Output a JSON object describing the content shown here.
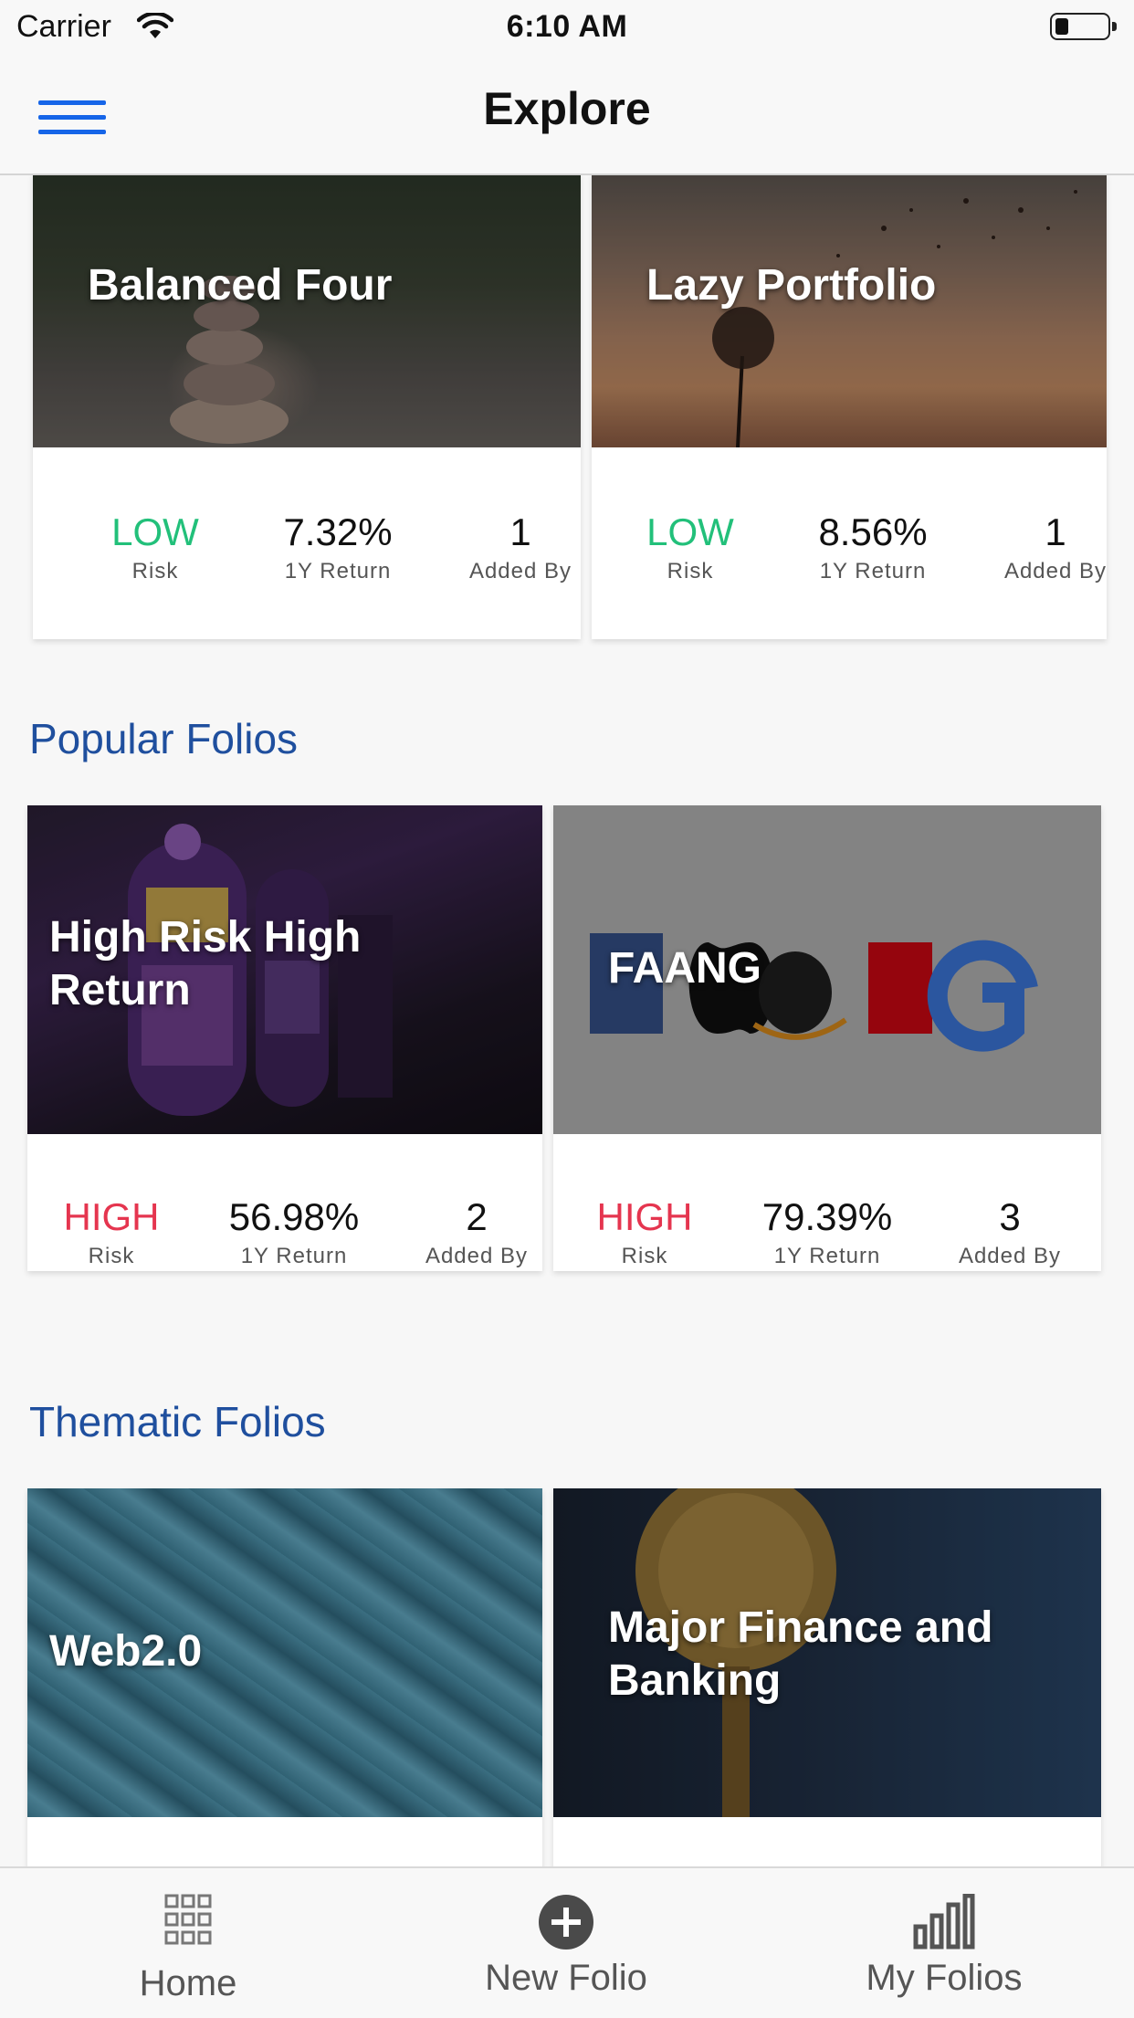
{
  "status_bar": {
    "carrier": "Carrier",
    "time": "6:10 AM"
  },
  "nav": {
    "title": "Explore"
  },
  "top_folios": [
    {
      "title": "Balanced Four",
      "risk": "LOW",
      "risk_label": "Risk",
      "return": "7.32%",
      "return_label": "1Y Return",
      "added_by": "1",
      "added_by_label": "Added By"
    },
    {
      "title": "Lazy Portfolio",
      "risk": "LOW",
      "risk_label": "Risk",
      "return": "8.56%",
      "return_label": "1Y Return",
      "added_by": "1",
      "added_by_label": "Added By"
    }
  ],
  "popular": {
    "heading": "Popular Folios",
    "items": [
      {
        "title": "High Risk High Return",
        "risk": "HIGH",
        "risk_label": "Risk",
        "return": "56.98%",
        "return_label": "1Y Return",
        "added_by": "2",
        "added_by_label": "Added By"
      },
      {
        "title": "FAANG",
        "risk": "HIGH",
        "risk_label": "Risk",
        "return": "79.39%",
        "return_label": "1Y Return",
        "added_by": "3",
        "added_by_label": "Added By"
      }
    ]
  },
  "thematic": {
    "heading": "Thematic Folios",
    "items": [
      {
        "title": "Web2.0"
      },
      {
        "title": "Major Finance and Banking"
      }
    ]
  },
  "tabbar": {
    "home": "Home",
    "new_folio": "New Folio",
    "my_folios": "My Folios"
  },
  "colors": {
    "accent": "#1665e8",
    "section_heading": "#1f4f9e",
    "risk_low": "#22c07a",
    "risk_high": "#e5354f"
  },
  "icons": {
    "menu": "hamburger-icon",
    "home": "grid-icon",
    "new_folio": "plus-circle-icon",
    "my_folios": "bar-chart-icon"
  }
}
